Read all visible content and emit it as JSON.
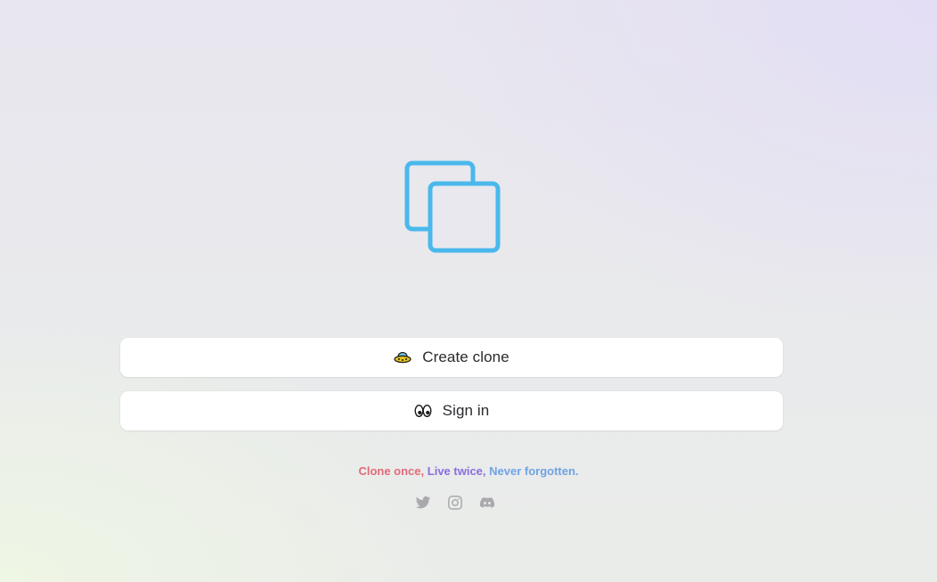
{
  "actions": {
    "create_label": "Create clone",
    "signin_label": "Sign in"
  },
  "tagline": {
    "part1": "Clone once,",
    "part2": "Live twice,",
    "part3": "Never forgotten."
  },
  "icons": {
    "logo": "copy-icon",
    "create": "ufo-icon",
    "signin": "eyes-icon",
    "social": [
      "twitter-icon",
      "instagram-icon",
      "discord-icon"
    ]
  },
  "colors": {
    "logo": "#4ab8ec",
    "tagline_1": "#e36a78",
    "tagline_2": "#8a6fe0",
    "tagline_3": "#6fa3e4",
    "social": "#a9a9ad"
  }
}
